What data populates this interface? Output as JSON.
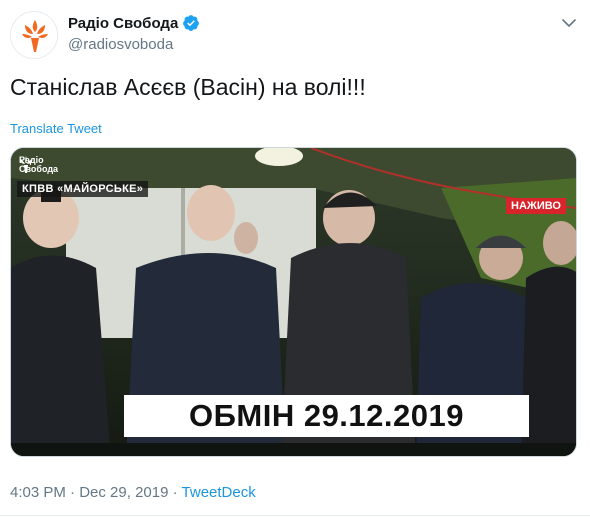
{
  "author": {
    "display_name": "Радіо Свобода",
    "handle": "@radiosvoboda",
    "verified": true,
    "avatar_icon": "radio-svoboda-torch-logo",
    "brand_color": "#f26a21"
  },
  "tweet": {
    "text": "Станіслав Асєєв (Васін) на волі!!!",
    "translate_label": "Translate Tweet"
  },
  "media": {
    "watermark_text_line1": "Радіо",
    "watermark_text_line2": "Свобода",
    "location_label": "КПВВ «МАЙОРСЬКЕ»",
    "live_badge": "НАЖИВО",
    "caption": "ОБМІН 29.12.2019"
  },
  "meta": {
    "time": "4:03 PM",
    "separator1": "·",
    "date": "Dec 29, 2019",
    "separator2": "·",
    "source": "TweetDeck"
  },
  "colors": {
    "link": "#1b95e0",
    "muted": "#657786",
    "live_red": "#d8242b"
  }
}
